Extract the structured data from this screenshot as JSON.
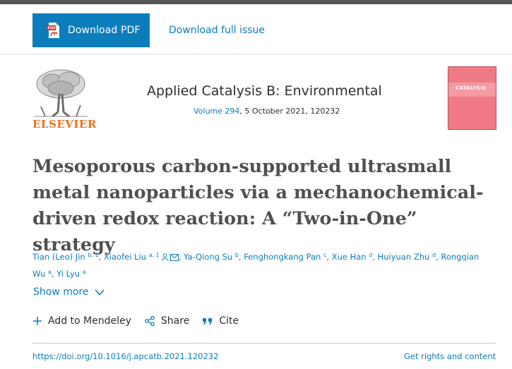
{
  "toolbar": {
    "download_pdf_label": "Download PDF",
    "pdf_icon_text": "PDF",
    "download_issue_label": "Download full issue"
  },
  "publisher": {
    "name": "ELSEVIER",
    "logo_icon": "tree-logo-icon"
  },
  "journal": {
    "title": "Applied Catalysis B: Environmental",
    "volume": "Volume 294",
    "details": ", 5 October 2021, 120232",
    "cover_text": "CATALYSIS"
  },
  "article": {
    "title": "Mesoporous carbon-supported ultrasmall metal nanoparticles via a mechanochemical-driven redox reaction: A “Two-in-One” strategy"
  },
  "authors": [
    {
      "name": "Tian (Leo) Jin",
      "sup": "b, 1",
      "sep": ", "
    },
    {
      "name": "Xiaofei Liu",
      "sup": "a, 1",
      "sep": ", "
    },
    {
      "name": "Ya-Qiong Su",
      "sup": "b",
      "sep": ", "
    },
    {
      "name": "Fenghongkang Pan",
      "sup": "c",
      "sep": ", "
    },
    {
      "name": "Xue Han",
      "sup": "d",
      "sep": ", "
    },
    {
      "name": "Huiyuan Zhu",
      "sup": "d",
      "sep": ", "
    },
    {
      "name": "Rongqian Wu",
      "sup": "a",
      "sep": ", "
    },
    {
      "name": "Yi Lyu",
      "sup": "a",
      "sep": ""
    }
  ],
  "show_more_label": "Show more",
  "actions": {
    "mendeley": "Add to Mendeley",
    "share": "Share",
    "cite": "Cite"
  },
  "footer": {
    "doi": "https://doi.org/10.1016/j.apcatb.2021.120232",
    "rights": "Get rights and content"
  },
  "colors": {
    "accent": "#0c7dbb",
    "elsevier_orange": "#e9711c",
    "cover_pink": "#ef7a86"
  }
}
